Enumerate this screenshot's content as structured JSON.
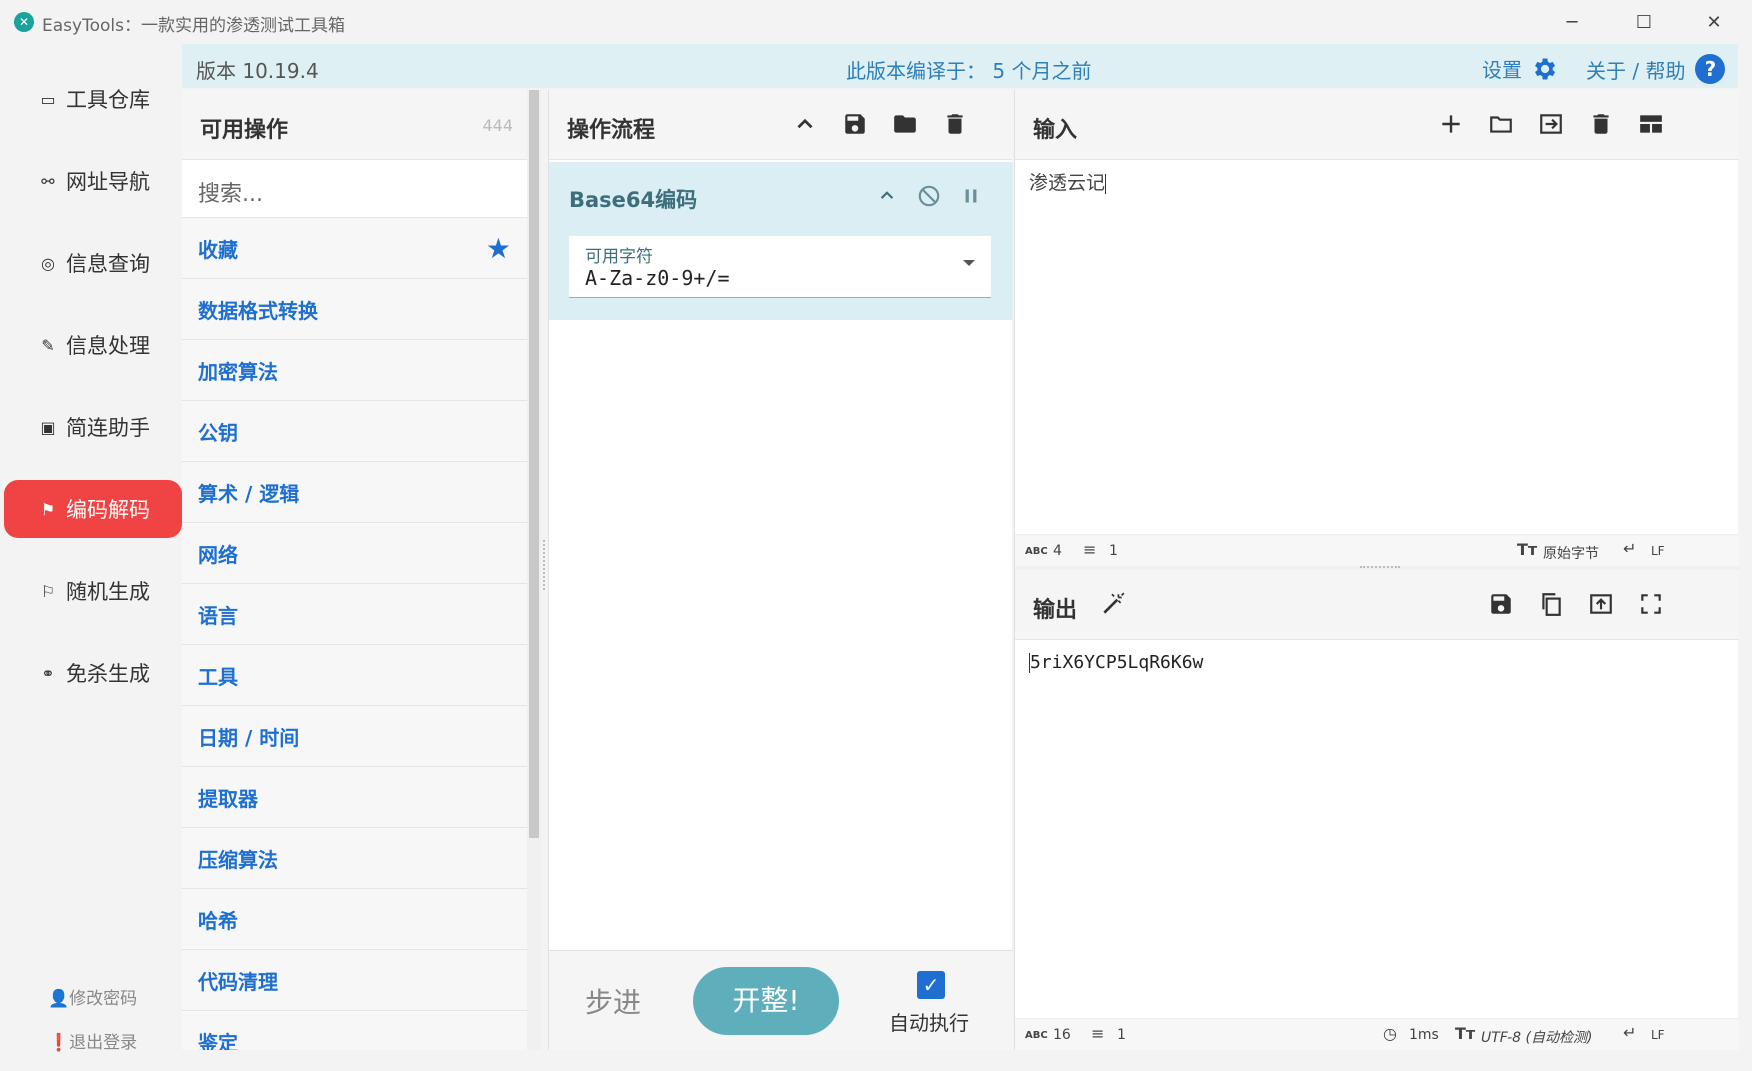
{
  "window": {
    "title": "EasyTools：一款实用的渗透测试工具箱",
    "minimize_glyph": "─",
    "maximize_glyph": "☐",
    "close_glyph": "✕"
  },
  "nav": {
    "items": [
      {
        "label": "工具仓库",
        "icon": "▭"
      },
      {
        "label": "网址导航",
        "icon": "⚯"
      },
      {
        "label": "信息查询",
        "icon": "◎"
      },
      {
        "label": "信息处理",
        "icon": "✎"
      },
      {
        "label": "简连助手",
        "icon": "▣"
      },
      {
        "label": "编码解码",
        "icon": "⚑"
      },
      {
        "label": "随机生成",
        "icon": "⚐"
      },
      {
        "label": "免杀生成",
        "icon": "⚭"
      }
    ],
    "active_index": 5,
    "footer": {
      "change_password": "👤修改密码",
      "logout": "❗退出登录"
    }
  },
  "header": {
    "version": "版本 10.19.4",
    "compiled": "此版本编译于：  5 个月之前",
    "settings": "设置",
    "about": "关于 / 帮助"
  },
  "operations": {
    "title": "可用操作",
    "count": "444",
    "search_placeholder": "搜索...",
    "categories": [
      "收藏",
      "数据格式转换",
      "加密算法",
      "公钥",
      "算术 / 逻辑",
      "网络",
      "语言",
      "工具",
      "日期 / 时间",
      "提取器",
      "压缩算法",
      "哈希",
      "代码清理",
      "鉴定"
    ]
  },
  "recipe": {
    "title": "操作流程",
    "operation": {
      "name": "Base64编码",
      "field_label": "可用字符",
      "field_value": "A-Za-z0-9+/="
    },
    "step_label": "步进",
    "bake_label": "开整!",
    "auto_bake_label": "自动执行",
    "auto_bake_checked": true
  },
  "input": {
    "title": "输入",
    "text": "渗透云记",
    "status": {
      "abc_label": "ABC",
      "length": "4",
      "lines": "1",
      "encoding": "原始字节",
      "eol": "LF"
    }
  },
  "output": {
    "title": "输出",
    "text": "5riX6YCP5LqR6K6w",
    "status": {
      "abc_label": "ABC",
      "length": "16",
      "lines": "1",
      "time": "1ms",
      "encoding": "UTF-8 (自动检测)",
      "eol": "LF"
    }
  },
  "colors": {
    "accent": "#1e6fd0",
    "nav_active": "#f04343",
    "bake": "#5eaebb",
    "header_bg": "#dff0f4"
  }
}
